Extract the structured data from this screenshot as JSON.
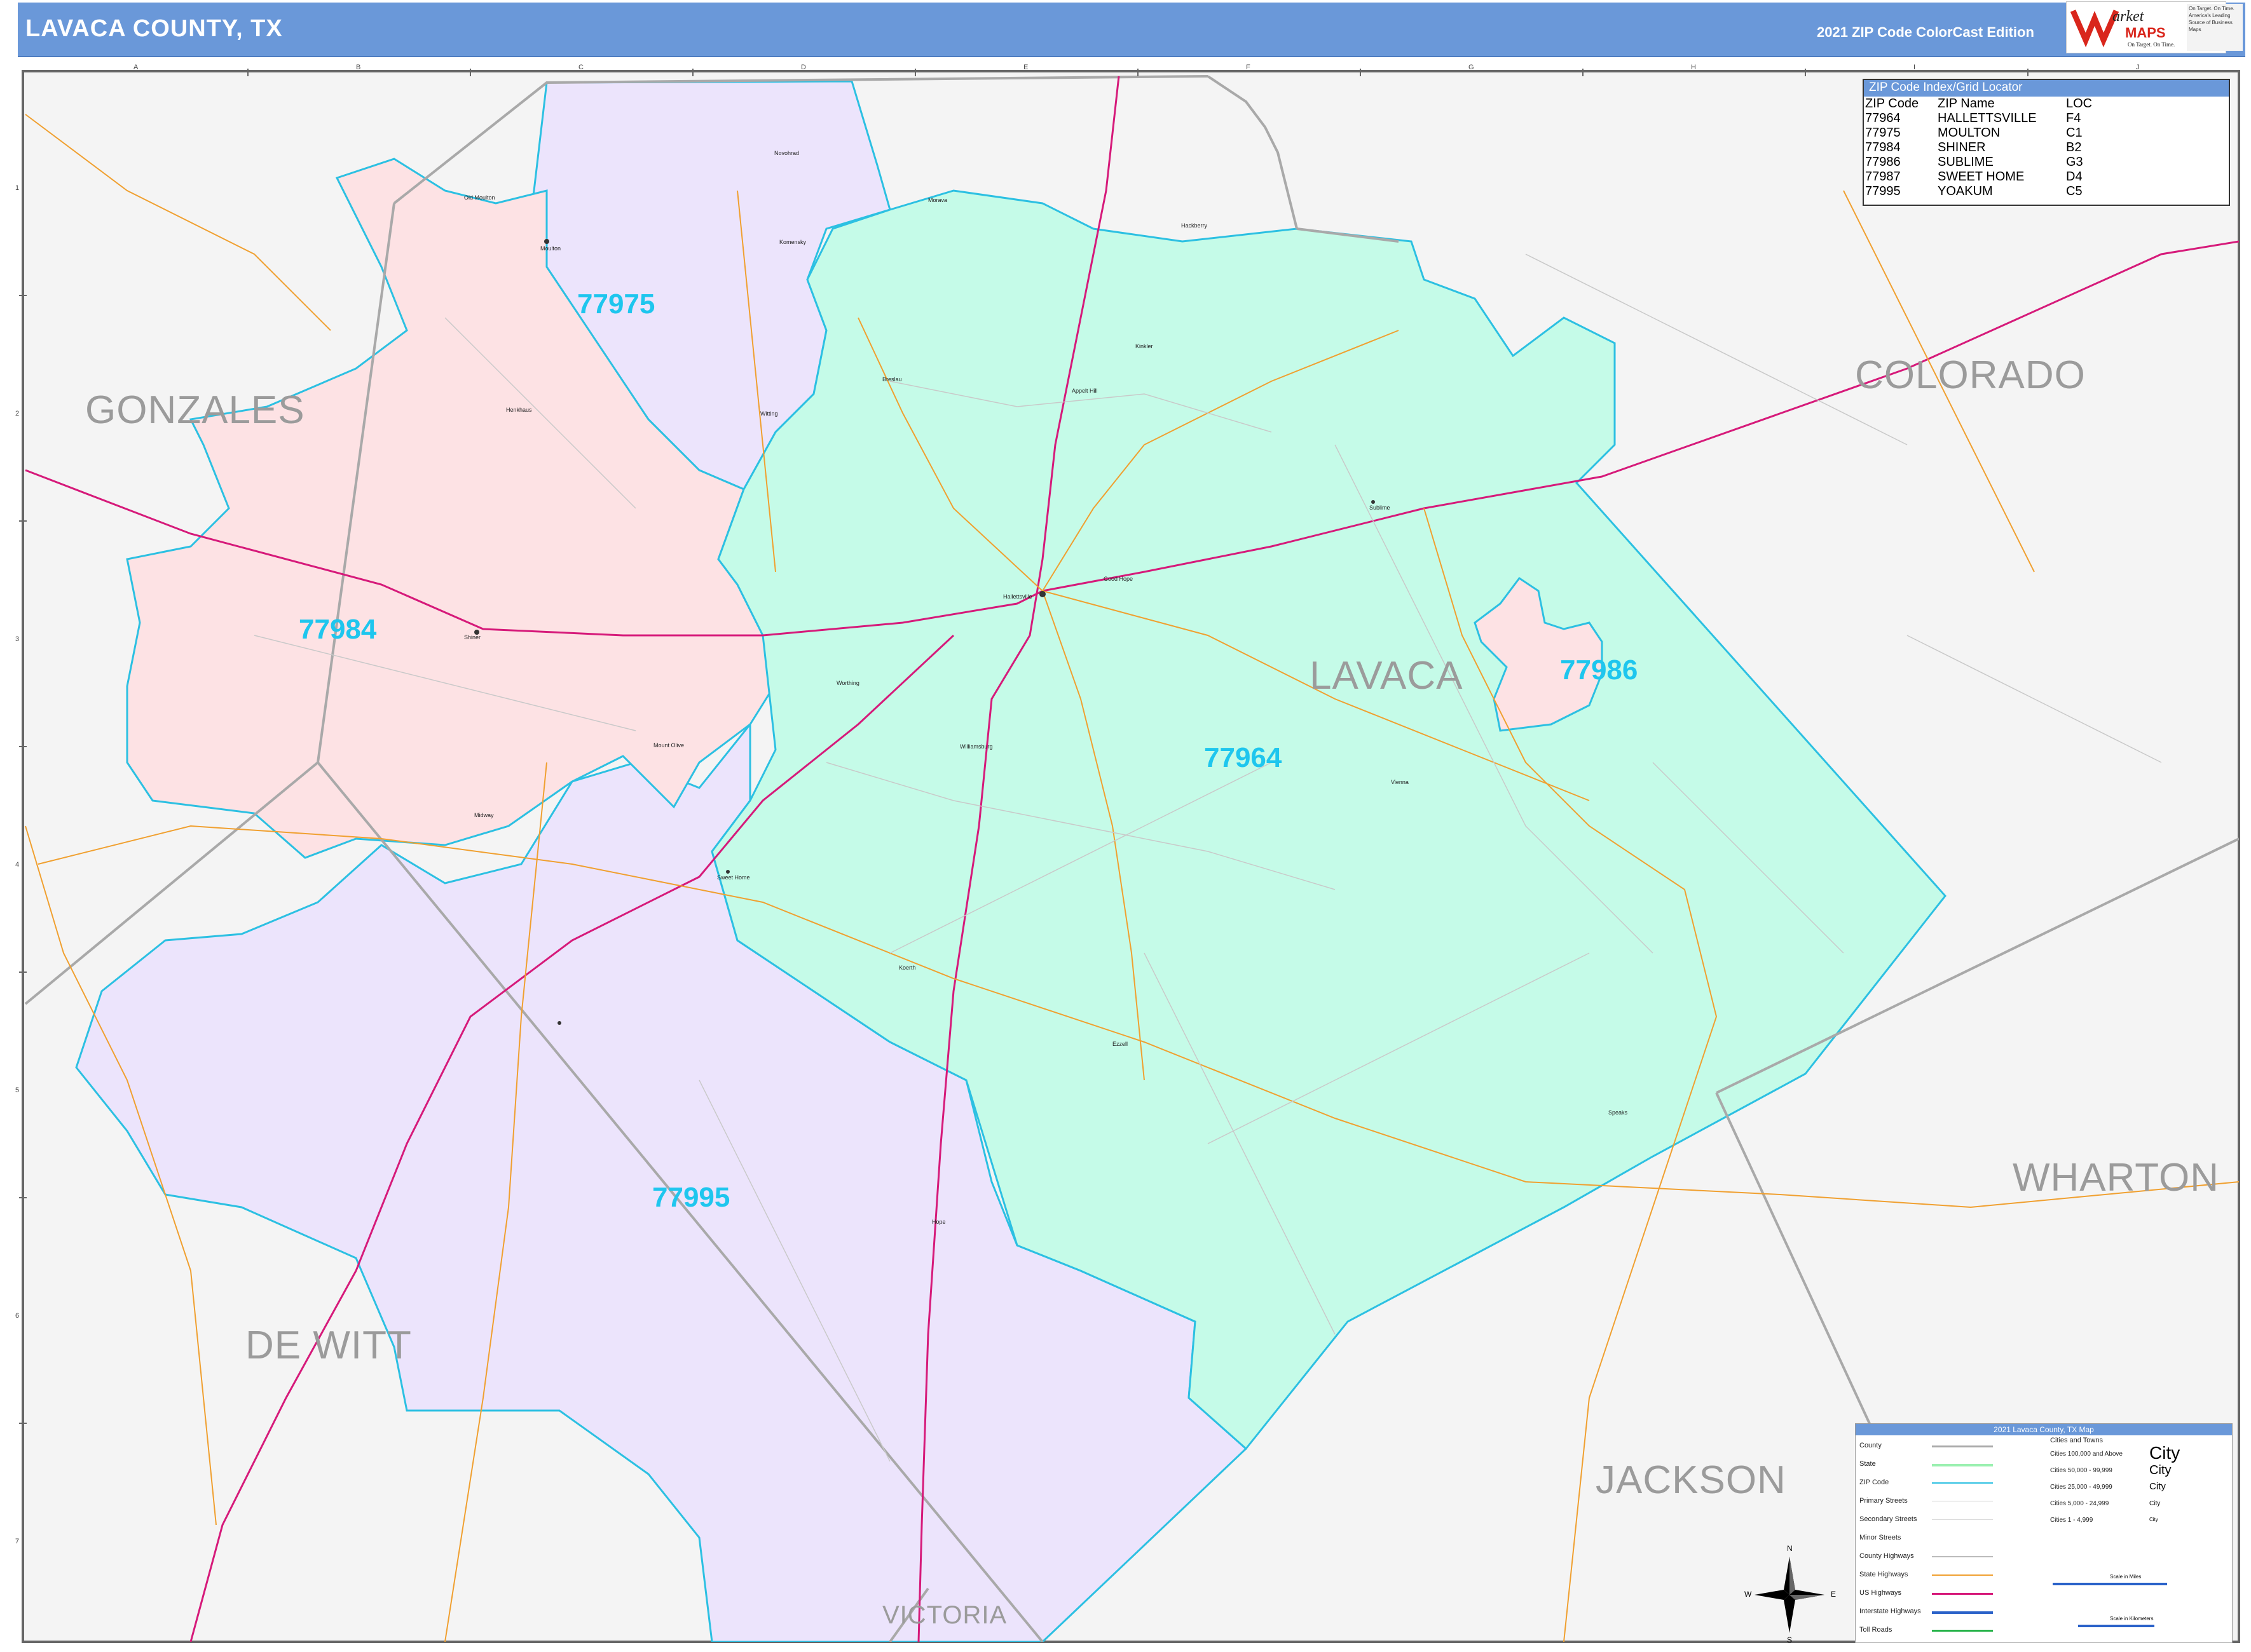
{
  "header": {
    "title": "LAVACA COUNTY, TX",
    "edition": "2021 ZIP Code ColorCast Edition",
    "logo_text": "Market MAPS",
    "logo_tagline": "On Target. On Time. America's Leading Source of Business Maps"
  },
  "colors": {
    "zip_77964": "#c5fbe8",
    "zip_77975": "#ece4fc",
    "zip_77984": "#fde2e4",
    "zip_77995": "#ece4fc",
    "zip_77986": "#fde2e4",
    "outside": "#f4f4f4",
    "header": "#6a98d9",
    "zip_boundary": "#2cc0e2",
    "county_boundary": "#a9a9a9",
    "us_highway": "#d61a7a",
    "state_highway": "#f0a030"
  },
  "counties": {
    "gonzales": "GONZALES",
    "colorado": "COLORADO",
    "lavaca": "LAVACA",
    "wharton": "WHARTON",
    "de_witt": "DE WITT",
    "jackson": "JACKSON",
    "victoria": "VICTORIA"
  },
  "zip_labels": {
    "z77975": "77975",
    "z77984": "77984",
    "z77986": "77986",
    "z77964": "77964",
    "z77995": "77995"
  },
  "towns": {
    "old_moulton": "Old Moulton",
    "moulton": "Moulton",
    "novohrad": "Novohrad",
    "komensky": "Komensky",
    "morava": "Morava",
    "hackberry": "Hackberry",
    "henkhaus": "Henkhaus",
    "breslau": "Breslau",
    "kinkler": "Kinkler",
    "appelt_hill": "Appelt Hill",
    "shiner": "Shiner",
    "hallettsville": "Hallettsville",
    "sublime": "Sublime",
    "good_hope": "Good Hope",
    "worthing": "Worthing",
    "mount_olive": "Mount Olive",
    "witting": "Witting",
    "williamsburg": "Williamsburg",
    "vienna": "Vienna",
    "midway": "Midway",
    "sweet_home": "Sweet Home",
    "koerth": "Koerth",
    "ezzell": "Ezzell",
    "speaks": "Speaks",
    "hope": "Hope"
  },
  "grid": {
    "letters": [
      "A",
      "B",
      "C",
      "D",
      "E",
      "F",
      "G",
      "H",
      "I",
      "J"
    ],
    "numbers": [
      "1",
      "2",
      "3",
      "4",
      "5",
      "6",
      "7"
    ]
  },
  "zip_index": {
    "title": "ZIP Code Index/Grid Locator",
    "headers": [
      "ZIP Code",
      "ZIP Name",
      "LOC"
    ],
    "rows": [
      [
        "77964",
        "HALLETTSVILLE",
        "F4"
      ],
      [
        "77975",
        "MOULTON",
        "C1"
      ],
      [
        "77984",
        "SHINER",
        "B2"
      ],
      [
        "77986",
        "SUBLIME",
        "G3"
      ],
      [
        "77987",
        "SWEET HOME",
        "D4"
      ],
      [
        "77995",
        "YOAKUM",
        "C5"
      ]
    ]
  },
  "legend": {
    "title": "2021 Lavaca County, TX Map",
    "items": [
      "County",
      "State",
      "ZIP Code",
      "Primary Streets",
      "Secondary Streets",
      "Minor Streets",
      "County Highways",
      "State Highways",
      "US Highways",
      "Interstate Highways",
      "Toll Roads"
    ],
    "cities_heading": "Cities and Towns",
    "city_classes": [
      "Cities 100,000 and Above",
      "Cities 50,000 - 99,999",
      "Cities 25,000 - 49,999",
      "Cities 5,000 - 24,999",
      "Cities 1 - 4,999"
    ],
    "city_samples": [
      "City",
      "City",
      "City",
      "City",
      "City"
    ],
    "scale_miles": "Scale in Miles",
    "scale_km": "Scale in Kilometers"
  },
  "compass": {
    "n": "N",
    "s": "S",
    "e": "E",
    "w": "W"
  }
}
